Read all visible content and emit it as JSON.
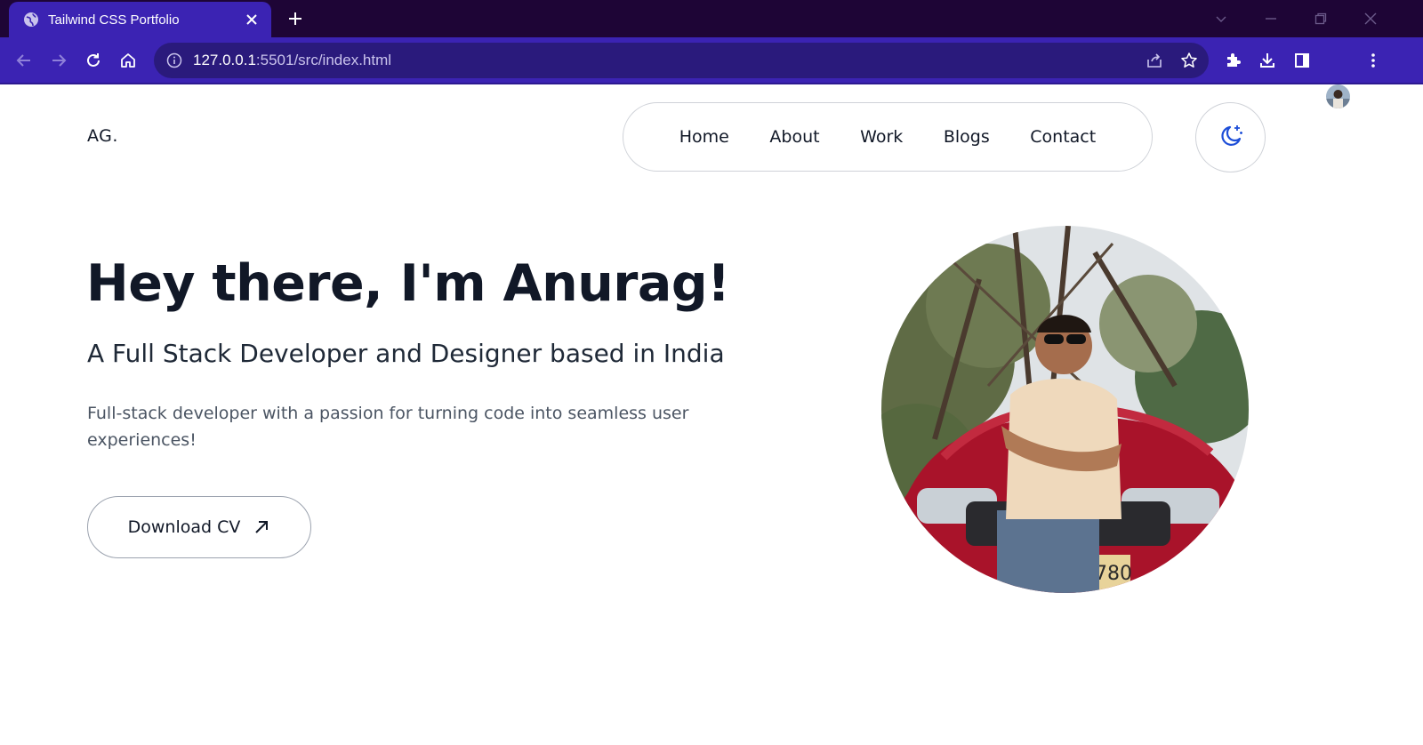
{
  "browser": {
    "tab_title": "Tailwind CSS Portfolio",
    "url_host": "127.0.0.1",
    "url_rest": ":5501/src/index.html",
    "icons": {
      "tab": "globe-icon",
      "close": "close-icon",
      "new_tab": "plus-icon",
      "back": "arrow-left-icon",
      "forward": "arrow-right-icon",
      "reload": "reload-icon",
      "home": "home-icon",
      "site_info": "info-icon",
      "share": "share-icon",
      "bookmark": "star-icon",
      "extensions": "puzzle-icon",
      "downloads": "download-icon",
      "side_panel": "side-panel-icon",
      "menu": "kebab-menu-icon"
    },
    "colors": {
      "tabstrip": "#1e0536",
      "toolbar": "#3b23b3",
      "omnibox": "#2a1a7c"
    }
  },
  "page": {
    "logo": "AG.",
    "nav": [
      "Home",
      "About",
      "Work",
      "Blogs",
      "Contact"
    ],
    "theme_toggle_icon": "moon-stars-icon",
    "hero": {
      "title": "Hey there, I'm Anurag!",
      "subtitle": "A Full Stack Developer and Designer based in India",
      "description": "Full-stack developer with a passion for turning code into seamless user experiences!",
      "cta_label": "Download CV",
      "cta_icon": "arrow-up-right-icon"
    },
    "portrait_plate_text": "780",
    "colors": {
      "text": "#111827",
      "accent_icon": "#1d4ed8",
      "border": "#cfd2d8"
    }
  }
}
